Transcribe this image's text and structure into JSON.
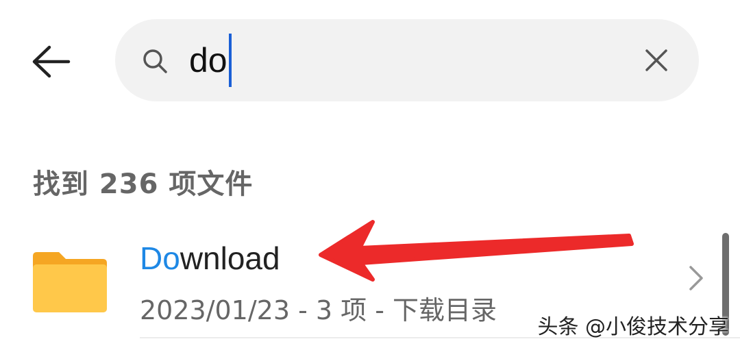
{
  "search": {
    "query": "do"
  },
  "results": {
    "count_label": "找到 236 项文件",
    "items": [
      {
        "name_match": "Do",
        "name_rest": "wnload",
        "meta": "2023/01/23 - 3 项 - 下载目录"
      }
    ]
  },
  "icons": {
    "back": "back-arrow-icon",
    "search": "search-icon",
    "clear": "close-icon",
    "folder": "folder-icon",
    "chevron": "chevron-right-icon"
  },
  "colors": {
    "highlight": "#1e88e5",
    "caret": "#1a5fd6",
    "folder": "#ffc84a",
    "annotation_arrow": "#ec2a2a"
  },
  "watermark": "头条 @小俊技术分享"
}
